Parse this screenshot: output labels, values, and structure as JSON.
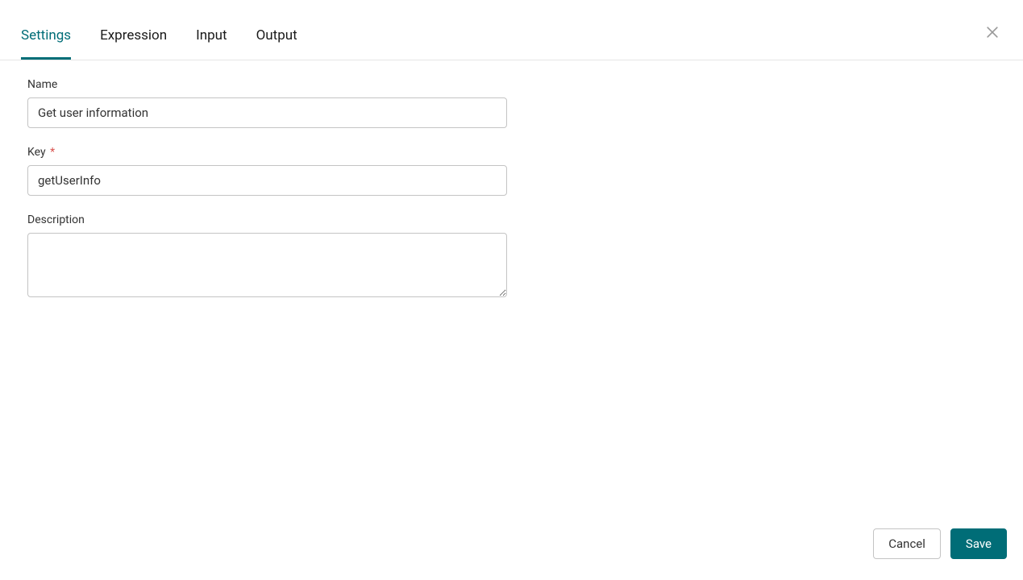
{
  "tabs": [
    {
      "label": "Settings",
      "active": true
    },
    {
      "label": "Expression",
      "active": false
    },
    {
      "label": "Input",
      "active": false
    },
    {
      "label": "Output",
      "active": false
    }
  ],
  "form": {
    "name": {
      "label": "Name",
      "value": "Get user information",
      "required": false
    },
    "key": {
      "label": "Key",
      "value": "getUserInfo",
      "required": true
    },
    "description": {
      "label": "Description",
      "value": "",
      "required": false
    }
  },
  "footer": {
    "cancel_label": "Cancel",
    "save_label": "Save"
  },
  "required_marker": "*"
}
